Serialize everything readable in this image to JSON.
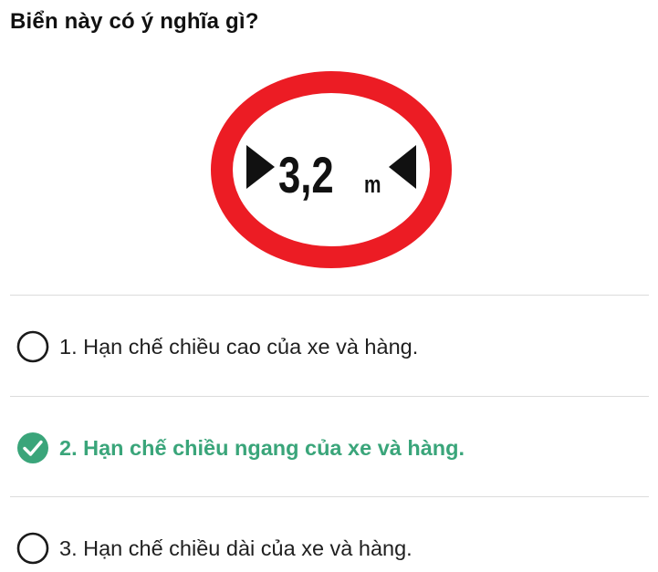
{
  "question": {
    "text": "Biển này có ý nghĩa gì?"
  },
  "sign": {
    "icon": "width-limit-sign-icon",
    "value": "3,2",
    "unit": "m",
    "ring_color": "#ec1c24",
    "text_color": "#111111"
  },
  "options": [
    {
      "label": "1. Hạn chế chiều cao của xe và hàng.",
      "selected": false
    },
    {
      "label": "2. Hạn chế chiều ngang của xe và hàng.",
      "selected": true
    },
    {
      "label": "3. Hạn chế chiều dài của xe và hàng.",
      "selected": false
    }
  ],
  "colors": {
    "correct": "#3aa57a",
    "radio_border": "#1a1a1a",
    "divider": "#dcdcdc"
  }
}
